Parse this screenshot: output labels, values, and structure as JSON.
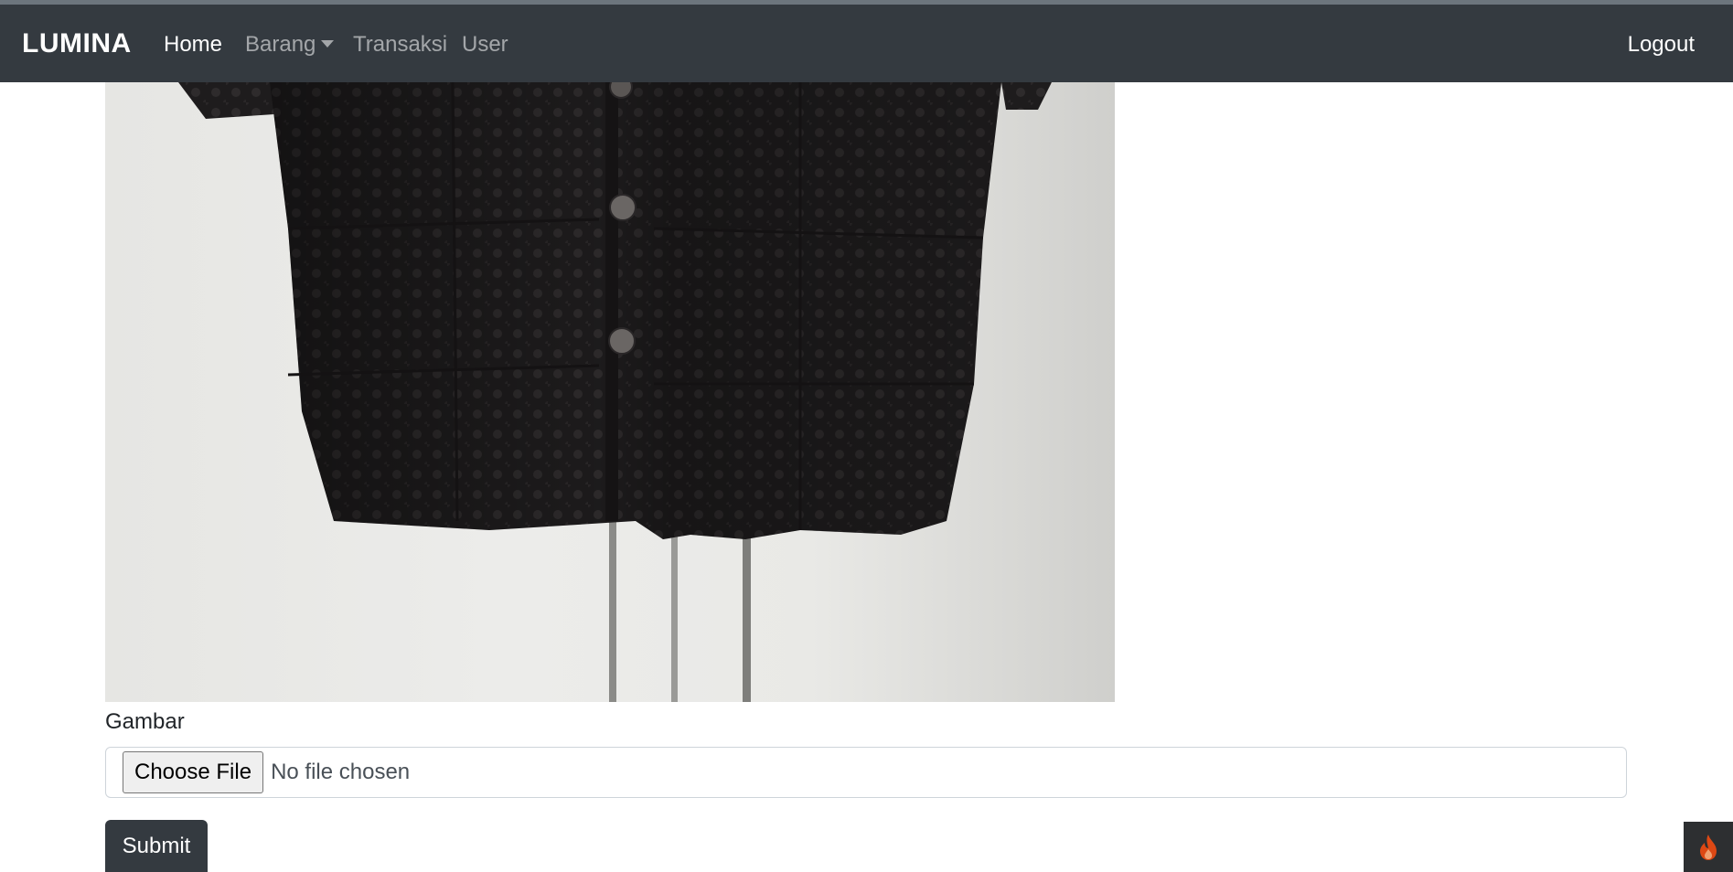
{
  "navbar": {
    "brand": "LUMINA",
    "items": [
      {
        "label": "Home",
        "active": true
      },
      {
        "label": "Barang",
        "dropdown": true
      },
      {
        "label": "Transaksi"
      },
      {
        "label": "User"
      }
    ],
    "logout": "Logout"
  },
  "form": {
    "image_label": "Gambar",
    "file_button": "Choose File",
    "file_status": "No file chosen",
    "submit_label": "Submit"
  },
  "colors": {
    "navbar_bg": "#343a40",
    "submit_bg": "#343a40",
    "debug_icon": "#dd4814"
  },
  "icons": {
    "debug_toolbar": "flame-icon"
  }
}
